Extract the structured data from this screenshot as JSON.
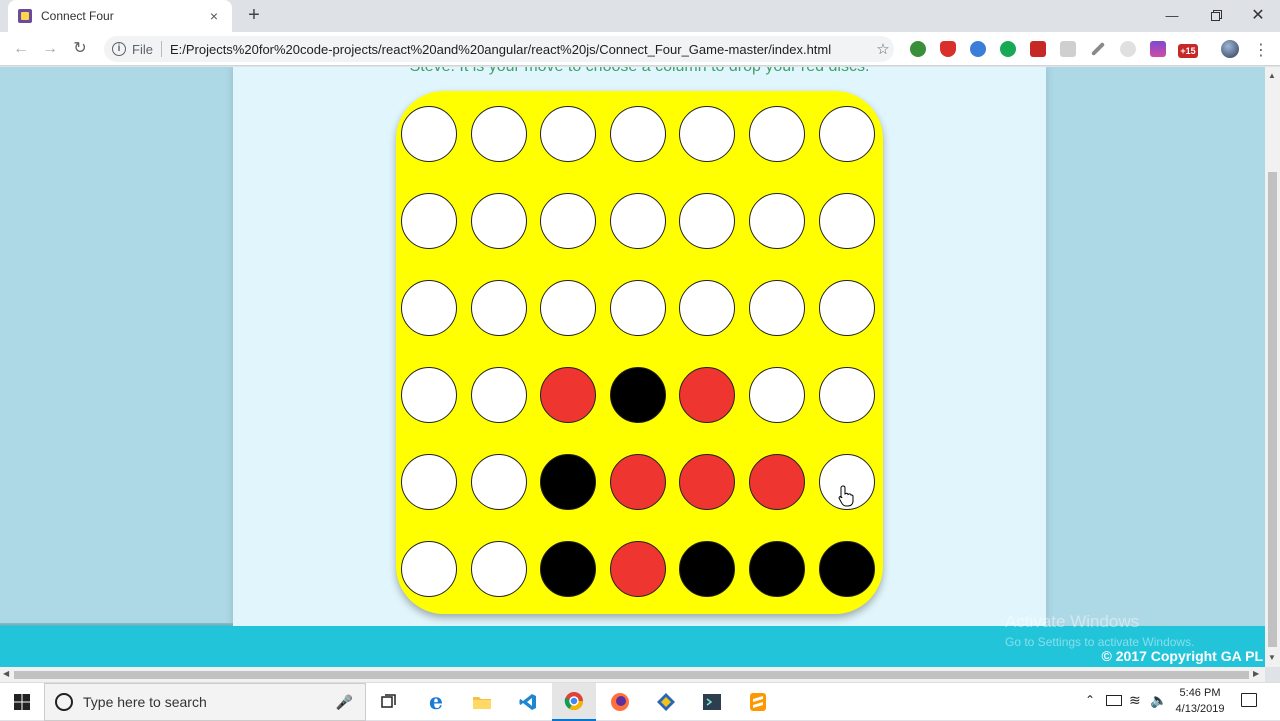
{
  "browser": {
    "tab_title": "Connect Four",
    "tab_close": "×",
    "new_tab": "+",
    "file_label": "File",
    "url": "E:/Projects%20for%20code-projects/react%20and%20angular/react%20js/Connect_Four_Game-master/index.html",
    "ext_badge": "+15"
  },
  "page": {
    "status_message": "Steve: It is your move to choose a column to drop your red discs.",
    "copyright": "© 2017 Copyright GA PL",
    "watermark_title": "Activate Windows",
    "watermark_sub": "Go to Settings to activate Windows."
  },
  "board": {
    "columns": 7,
    "rows": 6,
    "colors": {
      "board": "#ffff00",
      "empty": "#ffffff",
      "red": "#ee3530",
      "black": "#000000"
    },
    "grid": [
      [
        "empty",
        "empty",
        "empty",
        "empty",
        "empty",
        "empty",
        "empty"
      ],
      [
        "empty",
        "empty",
        "empty",
        "empty",
        "empty",
        "empty",
        "empty"
      ],
      [
        "empty",
        "empty",
        "empty",
        "empty",
        "empty",
        "empty",
        "empty"
      ],
      [
        "empty",
        "empty",
        "red",
        "black",
        "red",
        "empty",
        "empty"
      ],
      [
        "empty",
        "empty",
        "black",
        "red",
        "red",
        "red",
        "empty"
      ],
      [
        "empty",
        "empty",
        "black",
        "red",
        "black",
        "black",
        "black"
      ]
    ]
  },
  "taskbar": {
    "search_placeholder": "Type here to search",
    "time": "5:46 PM",
    "date": "4/13/2019"
  },
  "colors": {
    "page_side": "#add8e6",
    "page_center": "#e0f6fc",
    "footer": "#22c4da",
    "status_text": "#3fa06a"
  }
}
